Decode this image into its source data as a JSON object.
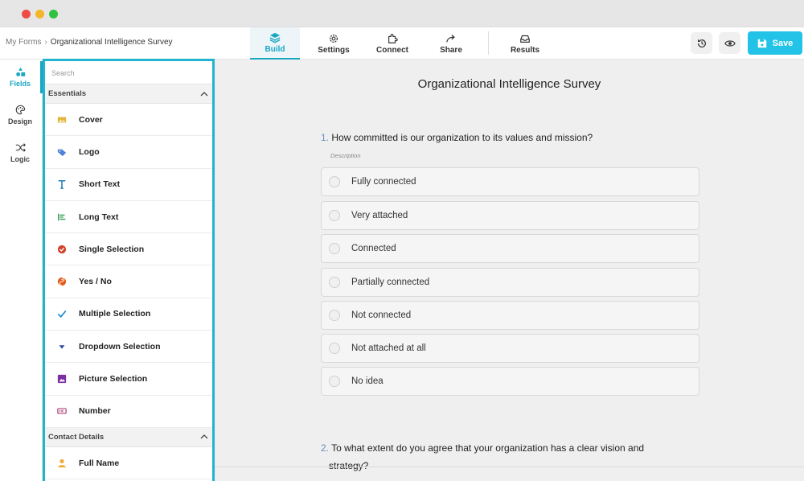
{
  "breadcrumb": {
    "root": "My Forms",
    "separator": "›",
    "current": "Organizational Intelligence Survey"
  },
  "nav": {
    "build": "Build",
    "settings": "Settings",
    "connect": "Connect",
    "share": "Share",
    "results": "Results"
  },
  "toolbar": {
    "save_label": "Save",
    "history_icon": "history-icon",
    "preview_icon": "eye-icon"
  },
  "rail": {
    "fields": "Fields",
    "design": "Design",
    "logic": "Logic"
  },
  "panel": {
    "search_placeholder": "Search",
    "sections": [
      {
        "title": "Essentials"
      },
      {
        "title": "Contact Details"
      }
    ],
    "fields": [
      {
        "label": "Cover",
        "icon": "cover-icon"
      },
      {
        "label": "Logo",
        "icon": "logo-icon"
      },
      {
        "label": "Short Text",
        "icon": "short-text-icon"
      },
      {
        "label": "Long Text",
        "icon": "long-text-icon"
      },
      {
        "label": "Single Selection",
        "icon": "single-selection-icon"
      },
      {
        "label": "Yes / No",
        "icon": "yes-no-icon"
      },
      {
        "label": "Multiple Selection",
        "icon": "checkmark-icon"
      },
      {
        "label": "Dropdown Selection",
        "icon": "dropdown-icon"
      },
      {
        "label": "Picture Selection",
        "icon": "picture-icon"
      },
      {
        "label": "Number",
        "icon": "number-icon"
      }
    ],
    "contact_fields": [
      {
        "label": "Full Name",
        "icon": "person-icon"
      }
    ]
  },
  "survey": {
    "title": "Organizational Intelligence Survey",
    "questions": [
      {
        "number": "1.",
        "text": "How committed is our organization to its values and mission?",
        "description": "Description",
        "options": [
          "Fully connected",
          "Very attached",
          "Connected",
          "Partially connected",
          "Not connected",
          "Not attached at all",
          "No idea"
        ]
      },
      {
        "number": "2.",
        "text_line1": "To what extent do you agree that your organization has a clear vision and",
        "text_line2": "strategy?"
      }
    ]
  },
  "colors": {
    "accent": "#22c3e6",
    "panel_border": "#22b3cf"
  }
}
